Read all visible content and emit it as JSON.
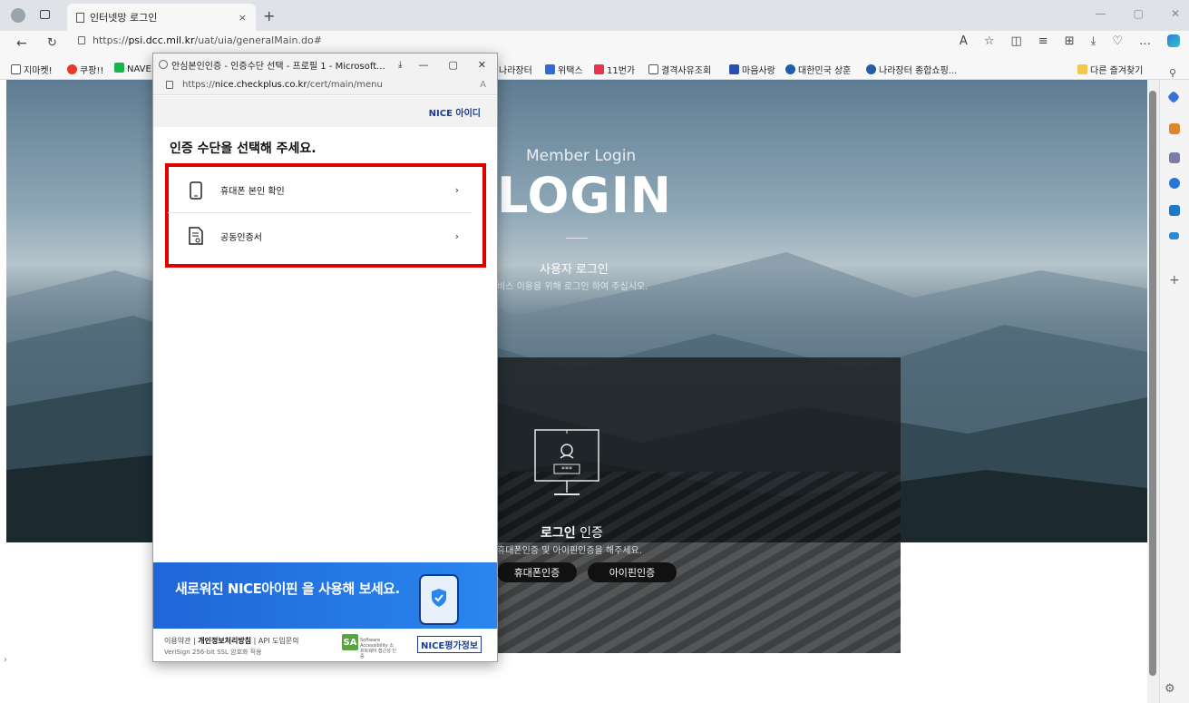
{
  "browser": {
    "tab_title": "인터넷망 로그인",
    "tab_close": "×",
    "new_tab": "+",
    "window_controls": [
      "—",
      "▢",
      "✕"
    ],
    "url_prefix": "https://",
    "url_domain": "psi.dcc.mil.kr",
    "url_path": "/uat/uia/generalMain.do#",
    "toolbar_icons": [
      "A",
      "☆",
      "◫",
      "≡",
      "⊞",
      "⤓",
      "♡",
      "…"
    ],
    "bookmarks": [
      "지마켓!",
      "쿠팡!!",
      "NAVE",
      "나라장터",
      "위택스",
      "11번가",
      "결격사유조회",
      "마음사랑",
      "대한민국 상훈",
      "나라장터 종합쇼핑...",
      "다른 즐겨찾기"
    ],
    "sidebar_plus": "+",
    "bottom_gear": "⚙",
    "left_arrow": "›"
  },
  "page": {
    "member_login": "Member Login",
    "login_title": "LOGIN",
    "user_login": "사용자 로그인",
    "user_desc": "비스 이용을 위해 로그인 하여 주십시오.",
    "login_cert_bold": "로그인",
    "login_cert_rest": " 인증",
    "login_cert_desc": "휴대폰인증 및 아이핀인증을 해주세요.",
    "btn_phone": "휴대폰인증",
    "btn_ipin": "아이핀인증",
    "monitor_password": "***"
  },
  "popup": {
    "window_title": "안심본인인증 - 인증수단 선택 - 프로필 1 - Microsoft...",
    "controls": [
      "—",
      "▢",
      "✕"
    ],
    "url_prefix": "https://",
    "url_domain": "nice.checkplus.co.kr",
    "url_path": "/cert/main/menu",
    "read_aloud": "A",
    "logo_prefix": "NICE",
    "logo_main": "아이디",
    "heading": "인증 수단을 선택해 주세요.",
    "options": [
      {
        "label": "휴대폰 본인 확인",
        "arrow": "›"
      },
      {
        "label": "공동인증서",
        "arrow": "›"
      }
    ],
    "banner_text": "새로워진 NICE아이핀 을 사용해 보세요.",
    "footer_terms": "이용약관",
    "footer_privacy": "개인정보처리방침",
    "footer_api": "API 도입문의",
    "footer_ssl": "VeriSign 256-bit SSL 암호화 적용",
    "sa_logo": "SA",
    "sa_text": "Software Accessibility 소프트웨어 접근성 인증",
    "rating_badge": "NICE평가정보"
  },
  "colors": {
    "highlight": "#e00000",
    "banner": "#1f66d9",
    "nice_blue": "#1a3d8f"
  }
}
